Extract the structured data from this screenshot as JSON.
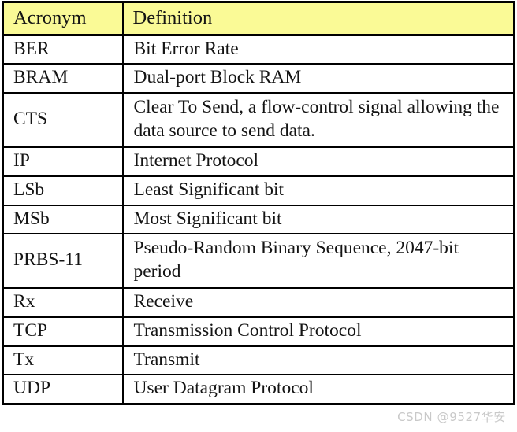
{
  "document": {
    "type": "acronym-definition-table",
    "header_background_color": "#fafa96",
    "border_color": "#000000",
    "text_color": "#141414"
  },
  "table": {
    "columns": [
      {
        "key": "acronym",
        "label": "Acronym"
      },
      {
        "key": "definition",
        "label": "Definition"
      }
    ],
    "rows": [
      {
        "acronym": "BER",
        "definition": "Bit Error Rate"
      },
      {
        "acronym": "BRAM",
        "definition": "Dual-port Block RAM"
      },
      {
        "acronym": "CTS",
        "definition": "Clear To Send, a flow-control signal allowing the data source to send data."
      },
      {
        "acronym": "IP",
        "definition": "Internet Protocol"
      },
      {
        "acronym": "LSb",
        "definition": "Least Significant bit"
      },
      {
        "acronym": "MSb",
        "definition": "Most Significant bit"
      },
      {
        "acronym": "PRBS-11",
        "definition": "Pseudo-Random Binary Sequence, 2047-bit period"
      },
      {
        "acronym": "Rx",
        "definition": "Receive"
      },
      {
        "acronym": "TCP",
        "definition": "Transmission Control Protocol"
      },
      {
        "acronym": "Tx",
        "definition": "Transmit"
      },
      {
        "acronym": "UDP",
        "definition": "User Datagram Protocol"
      }
    ]
  },
  "watermark": {
    "text": "CSDN @9527华安"
  }
}
